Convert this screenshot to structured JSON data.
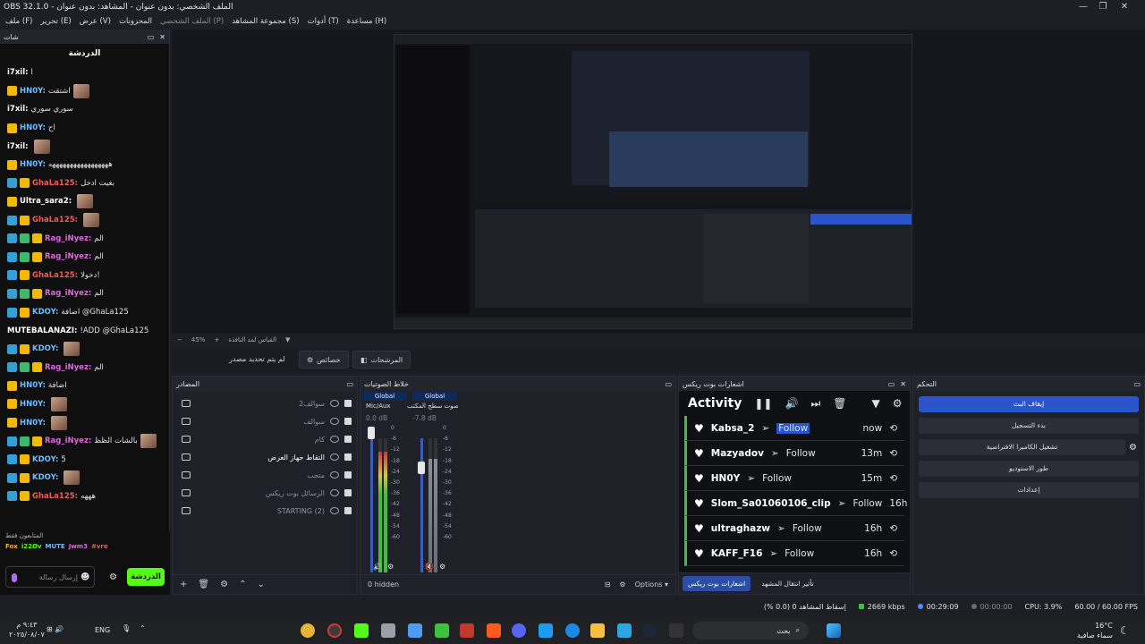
{
  "window": {
    "title": "OBS 32.1.0 - الملف الشخصي: بدون عنوان - المشاهد: بدون عنوان",
    "controls": [
      "—",
      "❐",
      "✕"
    ]
  },
  "menu": [
    "ملف (F)",
    "تحرير (E)",
    "عرض (V)",
    "المحزونات",
    "الملف الشخصي (P)",
    "مجموعة المشاهد (S)",
    "أدوات (T)",
    "مساعدة (H)"
  ],
  "chat": {
    "dock_label": "شات",
    "title": "الدردشة",
    "messages": [
      {
        "user": "i7xil:",
        "text": "ا",
        "color": "#ffffff",
        "badges": []
      },
      {
        "user": "HN0Y:",
        "text": "اشتقت",
        "color": "#6fbcff",
        "badges": [
          "crown"
        ],
        "emote": true
      },
      {
        "user": "i7xil:",
        "text": "سوري سوري",
        "color": "#ffffff",
        "badges": []
      },
      {
        "user": "HN0Y:",
        "text": "اح",
        "color": "#6fbcff",
        "badges": [
          "crown"
        ]
      },
      {
        "user": "i7xil:",
        "text": "",
        "color": "#ffffff",
        "badges": [],
        "emote": true
      },
      {
        "user": "HN0Y:",
        "text": "هههههههههههههههههه",
        "color": "#6fbcff",
        "badges": [
          "crown"
        ]
      },
      {
        "user": "GhaLa125:",
        "text": "بغيت ادخل",
        "color": "#f25a5a",
        "badges": [
          "blue",
          "crown"
        ]
      },
      {
        "user": "Ultra_sara2:",
        "text": "",
        "color": "#ffffff",
        "badges": [
          "crown"
        ],
        "emote": true
      },
      {
        "user": "GhaLa125:",
        "text": "",
        "color": "#f25a5a",
        "badges": [
          "blue",
          "crown"
        ],
        "emote": true
      },
      {
        "user": "Rag_iNyez:",
        "text": "الم",
        "color": "#d96cd9",
        "badges": [
          "blue",
          "green",
          "crown"
        ]
      },
      {
        "user": "Rag_iNyez:",
        "text": "الم",
        "color": "#d96cd9",
        "badges": [
          "blue",
          "green",
          "crown"
        ]
      },
      {
        "user": "GhaLa125:",
        "text": "دخولا!",
        "color": "#f25a5a",
        "badges": [
          "blue",
          "crown"
        ]
      },
      {
        "user": "Rag_iNyez:",
        "text": "الم",
        "color": "#d96cd9",
        "badges": [
          "blue",
          "green",
          "crown"
        ]
      },
      {
        "user": "KDOY:",
        "text": "اضافة @GhaLa125",
        "color": "#6fbcff",
        "badges": [
          "blue",
          "crown"
        ]
      },
      {
        "user": "MUTEBALANAZI:",
        "text": "!ADD @GhaLa125",
        "color": "#ffffff",
        "badges": []
      },
      {
        "user": "KDOY:",
        "text": "",
        "color": "#6fbcff",
        "badges": [
          "blue",
          "crown"
        ],
        "emote": true
      },
      {
        "user": "Rag_iNyez:",
        "text": "الم",
        "color": "#d96cd9",
        "badges": [
          "blue",
          "green",
          "crown"
        ]
      },
      {
        "user": "HN0Y:",
        "text": "اضافة",
        "color": "#6fbcff",
        "badges": [
          "crown"
        ]
      },
      {
        "user": "HN0Y:",
        "text": "",
        "color": "#6fbcff",
        "badges": [
          "crown"
        ],
        "emote": true
      },
      {
        "user": "HN0Y:",
        "text": "",
        "color": "#6fbcff",
        "badges": [
          "crown"
        ],
        "emote": true
      },
      {
        "user": "Rag_iNyez:",
        "text": "بالشات الظظ",
        "color": "#d96cd9",
        "badges": [
          "blue",
          "green",
          "crown"
        ],
        "emote": true
      },
      {
        "user": "KDOY:",
        "text": "5",
        "color": "#6fbcff",
        "badges": [
          "blue",
          "crown"
        ]
      },
      {
        "user": "KDOY:",
        "text": "",
        "color": "#6fbcff",
        "badges": [
          "blue",
          "crown"
        ],
        "emote": true
      },
      {
        "user": "GhaLa125:",
        "text": "هههه",
        "color": "#f25a5a",
        "badges": [
          "blue",
          "crown"
        ]
      }
    ],
    "followers_label": "المتابعون فقط",
    "viewer_row": [
      "Fox",
      "i22Øv",
      "MUTE",
      "Jwm3",
      "#vre"
    ],
    "input_placeholder": "إرسال رسالة",
    "send_label": "الدردشة"
  },
  "preview": {
    "zoom": "45%",
    "zoom_label": "القياس لمد النافذة"
  },
  "source_toolbar": {
    "no_source": "لم يتم تحديد مصدر",
    "properties": "خصائص",
    "filters": "المرشحات"
  },
  "sources": {
    "title": "المصادر",
    "items": [
      {
        "name": "سوالف2",
        "icon": "camera-icon"
      },
      {
        "name": "سوالف",
        "icon": "globe-icon"
      },
      {
        "name": "كام",
        "icon": "camera-icon"
      },
      {
        "name": "التقاط جهاز العرض",
        "icon": "monitor-icon",
        "visible": true
      },
      {
        "name": "متجب",
        "icon": "image-icon"
      },
      {
        "name": "الرسائل بوت ريكس",
        "icon": "globe-icon"
      },
      {
        "name": "STARTING (2)",
        "icon": "group-icon"
      }
    ]
  },
  "mixer": {
    "title": "خلاط الصوتيات",
    "channels": [
      {
        "name": "Mic/Aux",
        "db": "0.0 dB",
        "tag": "Global"
      },
      {
        "name": "صوت سطح المكتب",
        "db": "-7.8 dB",
        "tag": "Global"
      }
    ],
    "scale": [
      "0",
      "-6",
      "-12",
      "-18",
      "-24",
      "-30",
      "-36",
      "-42",
      "-48",
      "-54",
      "-60"
    ],
    "hidden": "0 hidden"
  },
  "activity": {
    "dock_label": "اشعارات بوت ريكس",
    "title": "Activity",
    "rows": [
      {
        "name": "Kabsa_2",
        "action": "Follow",
        "time": "now"
      },
      {
        "name": "Mazyadov",
        "action": "Follow",
        "time": "13m"
      },
      {
        "name": "HN0Y",
        "action": "Follow",
        "time": "15m"
      },
      {
        "name": "Slom_Sa01060106_clip",
        "action": "Follow",
        "time": "16h"
      },
      {
        "name": "ultraghazw",
        "action": "Follow",
        "time": "16h"
      },
      {
        "name": "KAFF_F16",
        "action": "Follow",
        "time": "16h"
      }
    ],
    "tabs": [
      "اشعارات بوت ريكس",
      "تأثير انتقال المشهد"
    ],
    "options": "Options"
  },
  "controls": {
    "title": "التحكم",
    "buttons": [
      "إيقاف البث",
      "بدء التسجيل",
      "تشغيل الكاميرا الافتراضية",
      "طور الاستوديو",
      "إعدادات"
    ]
  },
  "status": {
    "dropped": "إسقاط المشاهد 0 (0.0 %)",
    "bitrate": "2669 kbps",
    "stream_time": "00:29:09",
    "rec_time": "00:00:00",
    "cpu": "CPU: 3.9%",
    "fps": "60.00 / 60.00 FPS"
  },
  "taskbar": {
    "clock_time": "٩:٤٣ م",
    "clock_date": "٢٠٢٥/٠٨/٠٧",
    "lang": "ENG",
    "search": "بحث",
    "weather_temp": "16°C",
    "weather_desc": "سماء صافية"
  },
  "colors": {
    "accent": "#2a54c9",
    "kick_green": "#53fc18"
  }
}
